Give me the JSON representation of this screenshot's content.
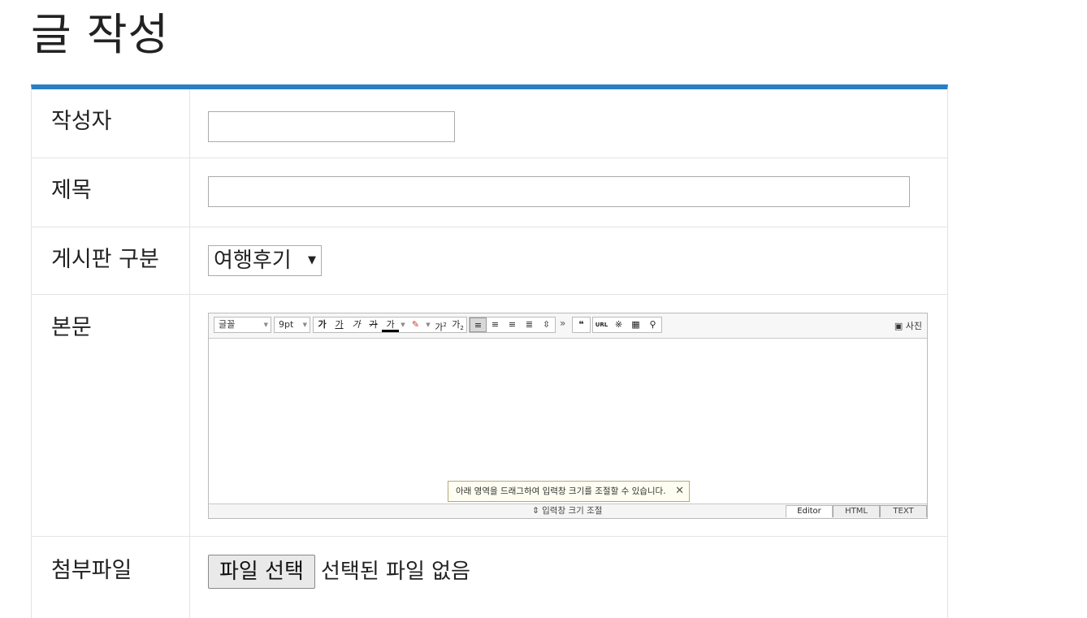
{
  "page": {
    "title": "글 작성",
    "accent_color": "#2a7fc4"
  },
  "form": {
    "author": {
      "label": "작성자",
      "value": ""
    },
    "subject": {
      "label": "제목",
      "value": ""
    },
    "category": {
      "label": "게시판 구분",
      "selected": "여행후기"
    },
    "body": {
      "label": "본문"
    },
    "attachment": {
      "label": "첨부파일",
      "button": "파일 선택",
      "status": "선택된 파일 없음"
    }
  },
  "editor": {
    "font_family": "글꼴",
    "font_size": "9pt",
    "format_buttons": [
      "가",
      "가",
      "가",
      "가",
      "가"
    ],
    "superscript": "가",
    "subscript": "가",
    "more": "»",
    "quote": "❝",
    "url": "URL",
    "photo": "사진",
    "tooltip": "아래 영역을 드래그하여 입력창 크기를 조절할 수 있습니다.",
    "tooltip_close": "✕",
    "resize_label": "⇕ 입력창 크기 조절",
    "modes": [
      "Editor",
      "HTML",
      "TEXT"
    ],
    "active_mode": "Editor"
  }
}
